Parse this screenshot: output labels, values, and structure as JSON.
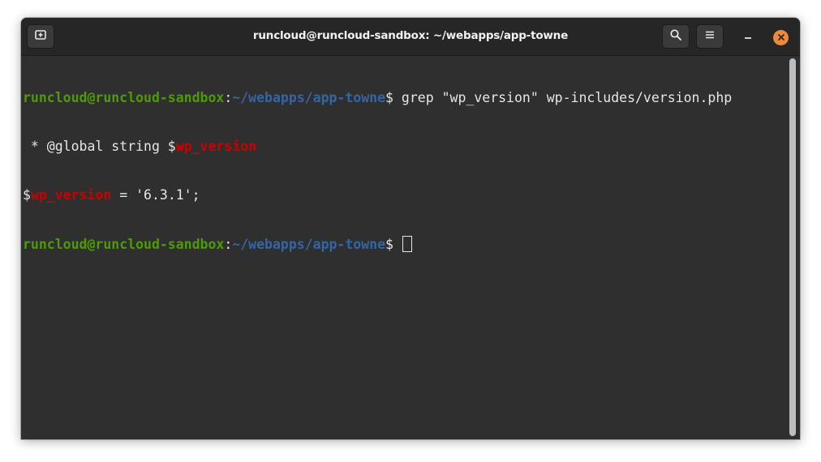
{
  "window": {
    "title": "runcloud@runcloud-sandbox: ~/webapps/app-towne"
  },
  "header": {
    "buttons": [
      {
        "name": "new-tab",
        "icon": "new-tab-icon"
      },
      {
        "name": "search",
        "icon": "search-icon"
      },
      {
        "name": "menu",
        "icon": "hamburger-menu-icon"
      },
      {
        "name": "minimize",
        "icon": "minimize-icon"
      },
      {
        "name": "close",
        "icon": "close-icon"
      }
    ],
    "close_color": "#ee8a3a"
  },
  "terminal": {
    "colors": {
      "background": "#2f2f2f",
      "text": "#e6e6e6",
      "user": "#4e9a06",
      "path": "#3465a4",
      "match": "#cc0000"
    },
    "line1": {
      "user": "runcloud@runcloud-sandbox",
      "sep": ":",
      "path": "~/webapps/app-towne",
      "prompt": "$",
      "command": " grep \"wp_version\" wp-includes/version.php"
    },
    "line2": {
      "prefix": " * @global string $",
      "match": "wp_version"
    },
    "line3": {
      "prefix": "$",
      "match": "wp_version",
      "suffix": " = '6.3.1';"
    },
    "line4": {
      "user": "runcloud@runcloud-sandbox",
      "sep": ":",
      "path": "~/webapps/app-towne",
      "prompt": "$",
      "after": " "
    }
  }
}
